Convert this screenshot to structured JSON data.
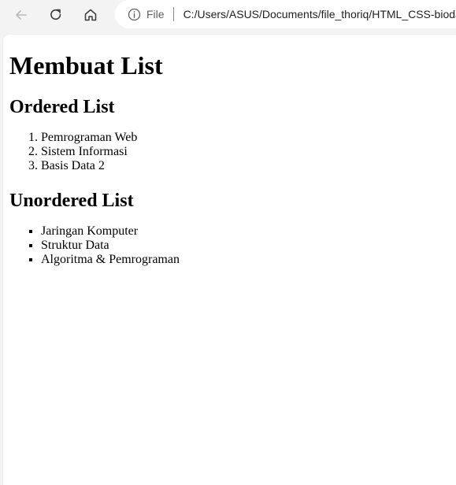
{
  "browser": {
    "address_prefix": "File",
    "url": "C:/Users/ASUS/Documents/file_thoriq/HTML_CSS-biodata"
  },
  "page": {
    "title": "Membuat List",
    "ordered_heading": "Ordered List",
    "ordered_items": [
      "Pemrograman Web",
      "Sistem Informasi",
      "Basis Data 2"
    ],
    "unordered_heading": "Unordered List",
    "unordered_items": [
      "Jaringan Komputer",
      "Struktur Data",
      "Algoritma & Pemrograman"
    ]
  }
}
